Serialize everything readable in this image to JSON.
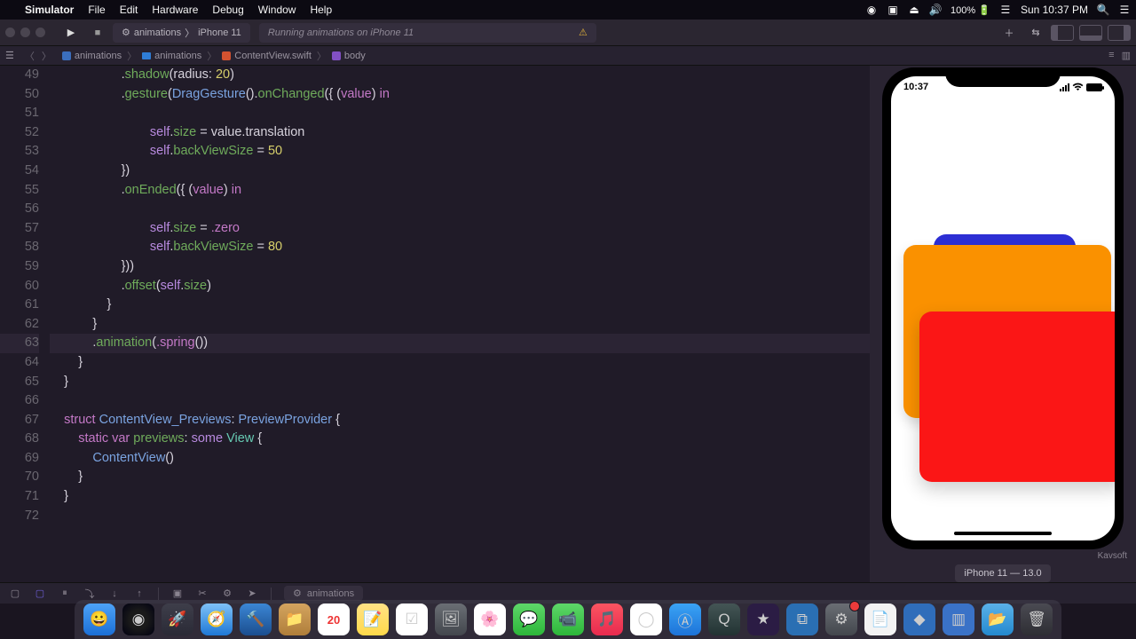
{
  "menubar": {
    "app": "Simulator",
    "items": [
      "File",
      "Edit",
      "Hardware",
      "Debug",
      "Window",
      "Help"
    ],
    "right": {
      "battery": "100%",
      "clock": "Sun 10:37 PM"
    }
  },
  "toolbar": {
    "scheme_target": "animations",
    "scheme_device": "iPhone 11",
    "status": "Running animations on iPhone 11"
  },
  "pathbar": {
    "project": "animations",
    "folder": "animations",
    "file": "ContentView.swift",
    "property": "body"
  },
  "editor": {
    "first_line": 49,
    "highlighted_line": 63,
    "lines": [
      {
        "indent": 5,
        "tokens": [
          [
            "op",
            "."
          ],
          [
            "fn",
            "shadow"
          ],
          [
            "par",
            "(radius: "
          ],
          [
            "num",
            "20"
          ],
          [
            "par",
            ")"
          ]
        ]
      },
      {
        "indent": 5,
        "tokens": [
          [
            "op",
            "."
          ],
          [
            "fn",
            "gesture"
          ],
          [
            "par",
            "("
          ],
          [
            "ty",
            "DragGesture"
          ],
          [
            "par",
            "()."
          ],
          [
            "fn",
            "onChanged"
          ],
          [
            "par",
            "({ ("
          ],
          [
            "kw",
            "value"
          ],
          [
            "par",
            ") "
          ],
          [
            "kw",
            "in"
          ]
        ]
      },
      {
        "indent": 5,
        "tokens": [
          [
            "par",
            ""
          ]
        ]
      },
      {
        "indent": 7,
        "tokens": [
          [
            "sel",
            "self"
          ],
          [
            "op",
            "."
          ],
          [
            "mem",
            "size"
          ],
          [
            "op",
            " = "
          ],
          [
            "par",
            "value.translation"
          ]
        ]
      },
      {
        "indent": 7,
        "tokens": [
          [
            "sel",
            "self"
          ],
          [
            "op",
            "."
          ],
          [
            "mem",
            "backViewSize"
          ],
          [
            "op",
            " = "
          ],
          [
            "num",
            "50"
          ]
        ]
      },
      {
        "indent": 5,
        "tokens": [
          [
            "par",
            "})"
          ]
        ]
      },
      {
        "indent": 5,
        "tokens": [
          [
            "op",
            "."
          ],
          [
            "fn",
            "onEnded"
          ],
          [
            "par",
            "({ ("
          ],
          [
            "kw",
            "value"
          ],
          [
            "par",
            ") "
          ],
          [
            "kw",
            "in"
          ]
        ]
      },
      {
        "indent": 5,
        "tokens": [
          [
            "par",
            ""
          ]
        ]
      },
      {
        "indent": 7,
        "tokens": [
          [
            "sel",
            "self"
          ],
          [
            "op",
            "."
          ],
          [
            "mem",
            "size"
          ],
          [
            "op",
            " = "
          ],
          [
            "en",
            ".zero"
          ]
        ]
      },
      {
        "indent": 7,
        "tokens": [
          [
            "sel",
            "self"
          ],
          [
            "op",
            "."
          ],
          [
            "mem",
            "backViewSize"
          ],
          [
            "op",
            " = "
          ],
          [
            "num",
            "80"
          ]
        ]
      },
      {
        "indent": 5,
        "tokens": [
          [
            "par",
            "}))"
          ]
        ]
      },
      {
        "indent": 5,
        "tokens": [
          [
            "op",
            "."
          ],
          [
            "fn",
            "offset"
          ],
          [
            "par",
            "("
          ],
          [
            "sel",
            "self"
          ],
          [
            "op",
            "."
          ],
          [
            "mem",
            "size"
          ],
          [
            "par",
            ")"
          ]
        ]
      },
      {
        "indent": 4,
        "tokens": [
          [
            "par",
            "}"
          ]
        ]
      },
      {
        "indent": 3,
        "tokens": [
          [
            "par",
            "}"
          ]
        ]
      },
      {
        "indent": 3,
        "tokens": [
          [
            "op",
            "."
          ],
          [
            "fn",
            "animation"
          ],
          [
            "par",
            "("
          ],
          [
            "en",
            ".spring"
          ],
          [
            "par",
            "())"
          ]
        ]
      },
      {
        "indent": 2,
        "tokens": [
          [
            "par",
            "}"
          ]
        ]
      },
      {
        "indent": 1,
        "tokens": [
          [
            "par",
            "}"
          ]
        ]
      },
      {
        "indent": 1,
        "tokens": [
          [
            "par",
            ""
          ]
        ]
      },
      {
        "indent": 1,
        "tokens": [
          [
            "kw",
            "struct"
          ],
          [
            "par",
            " "
          ],
          [
            "ty",
            "ContentView_Previews"
          ],
          [
            "op",
            ": "
          ],
          [
            "ty",
            "PreviewProvider"
          ],
          [
            "par",
            " {"
          ]
        ]
      },
      {
        "indent": 2,
        "tokens": [
          [
            "kw",
            "static"
          ],
          [
            "par",
            " "
          ],
          [
            "kw",
            "var"
          ],
          [
            "par",
            " "
          ],
          [
            "mem",
            "previews"
          ],
          [
            "op",
            ": "
          ],
          [
            "sel",
            "some"
          ],
          [
            "par",
            " "
          ],
          [
            "ty2",
            "View"
          ],
          [
            "par",
            " {"
          ]
        ]
      },
      {
        "indent": 3,
        "tokens": [
          [
            "ty",
            "ContentView"
          ],
          [
            "par",
            "()"
          ]
        ]
      },
      {
        "indent": 2,
        "tokens": [
          [
            "par",
            "}"
          ]
        ]
      },
      {
        "indent": 1,
        "tokens": [
          [
            "par",
            "}"
          ]
        ]
      },
      {
        "indent": 1,
        "tokens": [
          [
            "par",
            ""
          ]
        ]
      }
    ]
  },
  "simulator": {
    "time": "10:37",
    "footer": "Kavsoft",
    "device_label": "iPhone 11 — 13.0"
  },
  "debugbar": {
    "scheme": "animations"
  },
  "dock": {
    "cal_date": "20"
  }
}
